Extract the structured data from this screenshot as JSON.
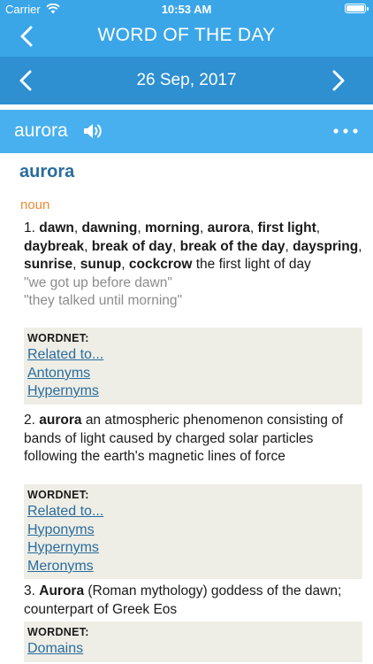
{
  "status": {
    "carrier": "Carrier",
    "time": "10:53 AM"
  },
  "nav": {
    "title": "WORD OF THE DAY"
  },
  "date": {
    "label": "26 Sep, 2017"
  },
  "word": {
    "title": "aurora"
  },
  "entry": {
    "headword": "aurora",
    "pos": "noun",
    "senses": [
      {
        "number": "1.",
        "terms": [
          "dawn",
          "dawning",
          "morning",
          "aurora",
          "first light",
          "daybreak",
          "break of day",
          "break of the day",
          "dayspring",
          "sunrise",
          "sunup",
          "cockcrow"
        ],
        "definition": "the first light of day",
        "examples": [
          "\"we got up before dawn\"",
          "\"they talked until morning\""
        ],
        "wordnet_label": "WORDNET:",
        "links": [
          "Related to...",
          "Antonyms",
          "Hypernyms"
        ]
      },
      {
        "number": "2.",
        "terms": [
          "aurora"
        ],
        "definition": "an atmospheric phenomenon consisting of bands of light caused by charged solar particles following the earth's magnetic lines of force",
        "examples": [],
        "wordnet_label": "WORDNET:",
        "links": [
          "Related to...",
          "Hyponyms",
          "Hypernyms",
          "Meronyms"
        ]
      },
      {
        "number": "3.",
        "terms": [
          "Aurora"
        ],
        "definition": "(Roman mythology) goddess of the dawn; counterpart of Greek Eos",
        "examples": [],
        "wordnet_label": "WORDNET:",
        "links": [
          "Domains"
        ]
      }
    ]
  },
  "colors": {
    "header": "#3aa6e8",
    "datebar": "#2e8fd1",
    "wordbar": "#48b0ee",
    "headword": "#2a6c9e",
    "pos": "#ee8a33",
    "wordnet_bg": "#eeeee6"
  }
}
